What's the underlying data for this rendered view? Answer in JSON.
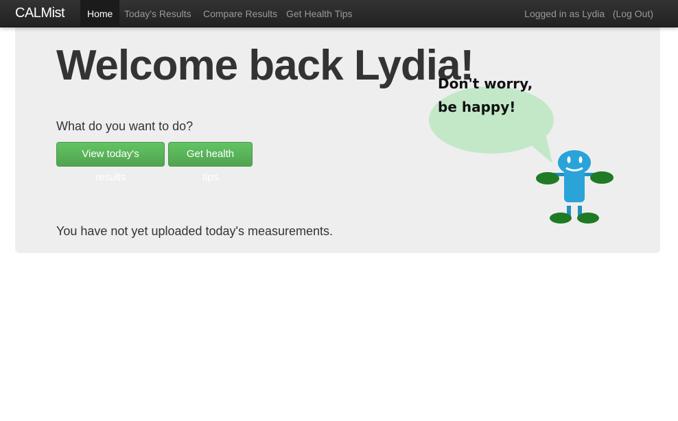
{
  "nav": {
    "brand": "CALMist",
    "items": [
      {
        "label": "Home",
        "active": true
      },
      {
        "label": "Today's Results"
      },
      {
        "label": "Compare Results"
      },
      {
        "label": "Get Health Tips"
      }
    ],
    "logged_in": "Logged in as Lydia",
    "logout": "(Log Out)"
  },
  "main": {
    "title": "Welcome back Lydia!",
    "prompt": "What do you want to do?",
    "buttons": [
      "View today's results",
      "Get health tips"
    ],
    "note": "You have not yet uploaded today's measurements.",
    "bubble": [
      "Don't worry,",
      "be happy!"
    ]
  },
  "colors": {
    "button": "#5bb75b",
    "bubble": "#c2e8c8",
    "mascot_body": "#2aa3d8",
    "mascot_hands": "#1f7a24"
  }
}
